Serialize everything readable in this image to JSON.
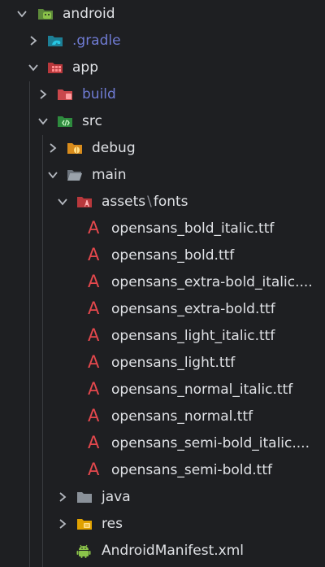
{
  "tree": {
    "android": "android",
    "gradle": ".gradle",
    "app": "app",
    "build": "build",
    "src": "src",
    "debug": "debug",
    "main": "main",
    "assets": "assets",
    "assets_sep": "\\",
    "fonts": "fonts",
    "files": [
      "opensans_bold_italic.ttf",
      "opensans_bold.ttf",
      "opensans_extra-bold_italic....",
      "opensans_extra-bold.ttf",
      "opensans_light_italic.ttf",
      "opensans_light.ttf",
      "opensans_normal_italic.ttf",
      "opensans_normal.ttf",
      "opensans_semi-bold_italic....",
      "opensans_semi-bold.ttf"
    ],
    "java": "java",
    "res": "res",
    "manifest": "AndroidManifest.xml"
  },
  "icons": {
    "font_glyph": "A"
  },
  "colors": {
    "background": "#1e1f22",
    "text": "#dfe1e5",
    "excluded_text": "#6f7bd3",
    "font_icon": "#e5484d",
    "android_green": "#8bc34a",
    "gradle_teal": "#26a7c4",
    "app_red": "#e5484d",
    "src_green": "#4caf50",
    "debug_orange": "#f0a732",
    "main_gray": "#8a9199",
    "res_yellow": "#f4b400"
  }
}
